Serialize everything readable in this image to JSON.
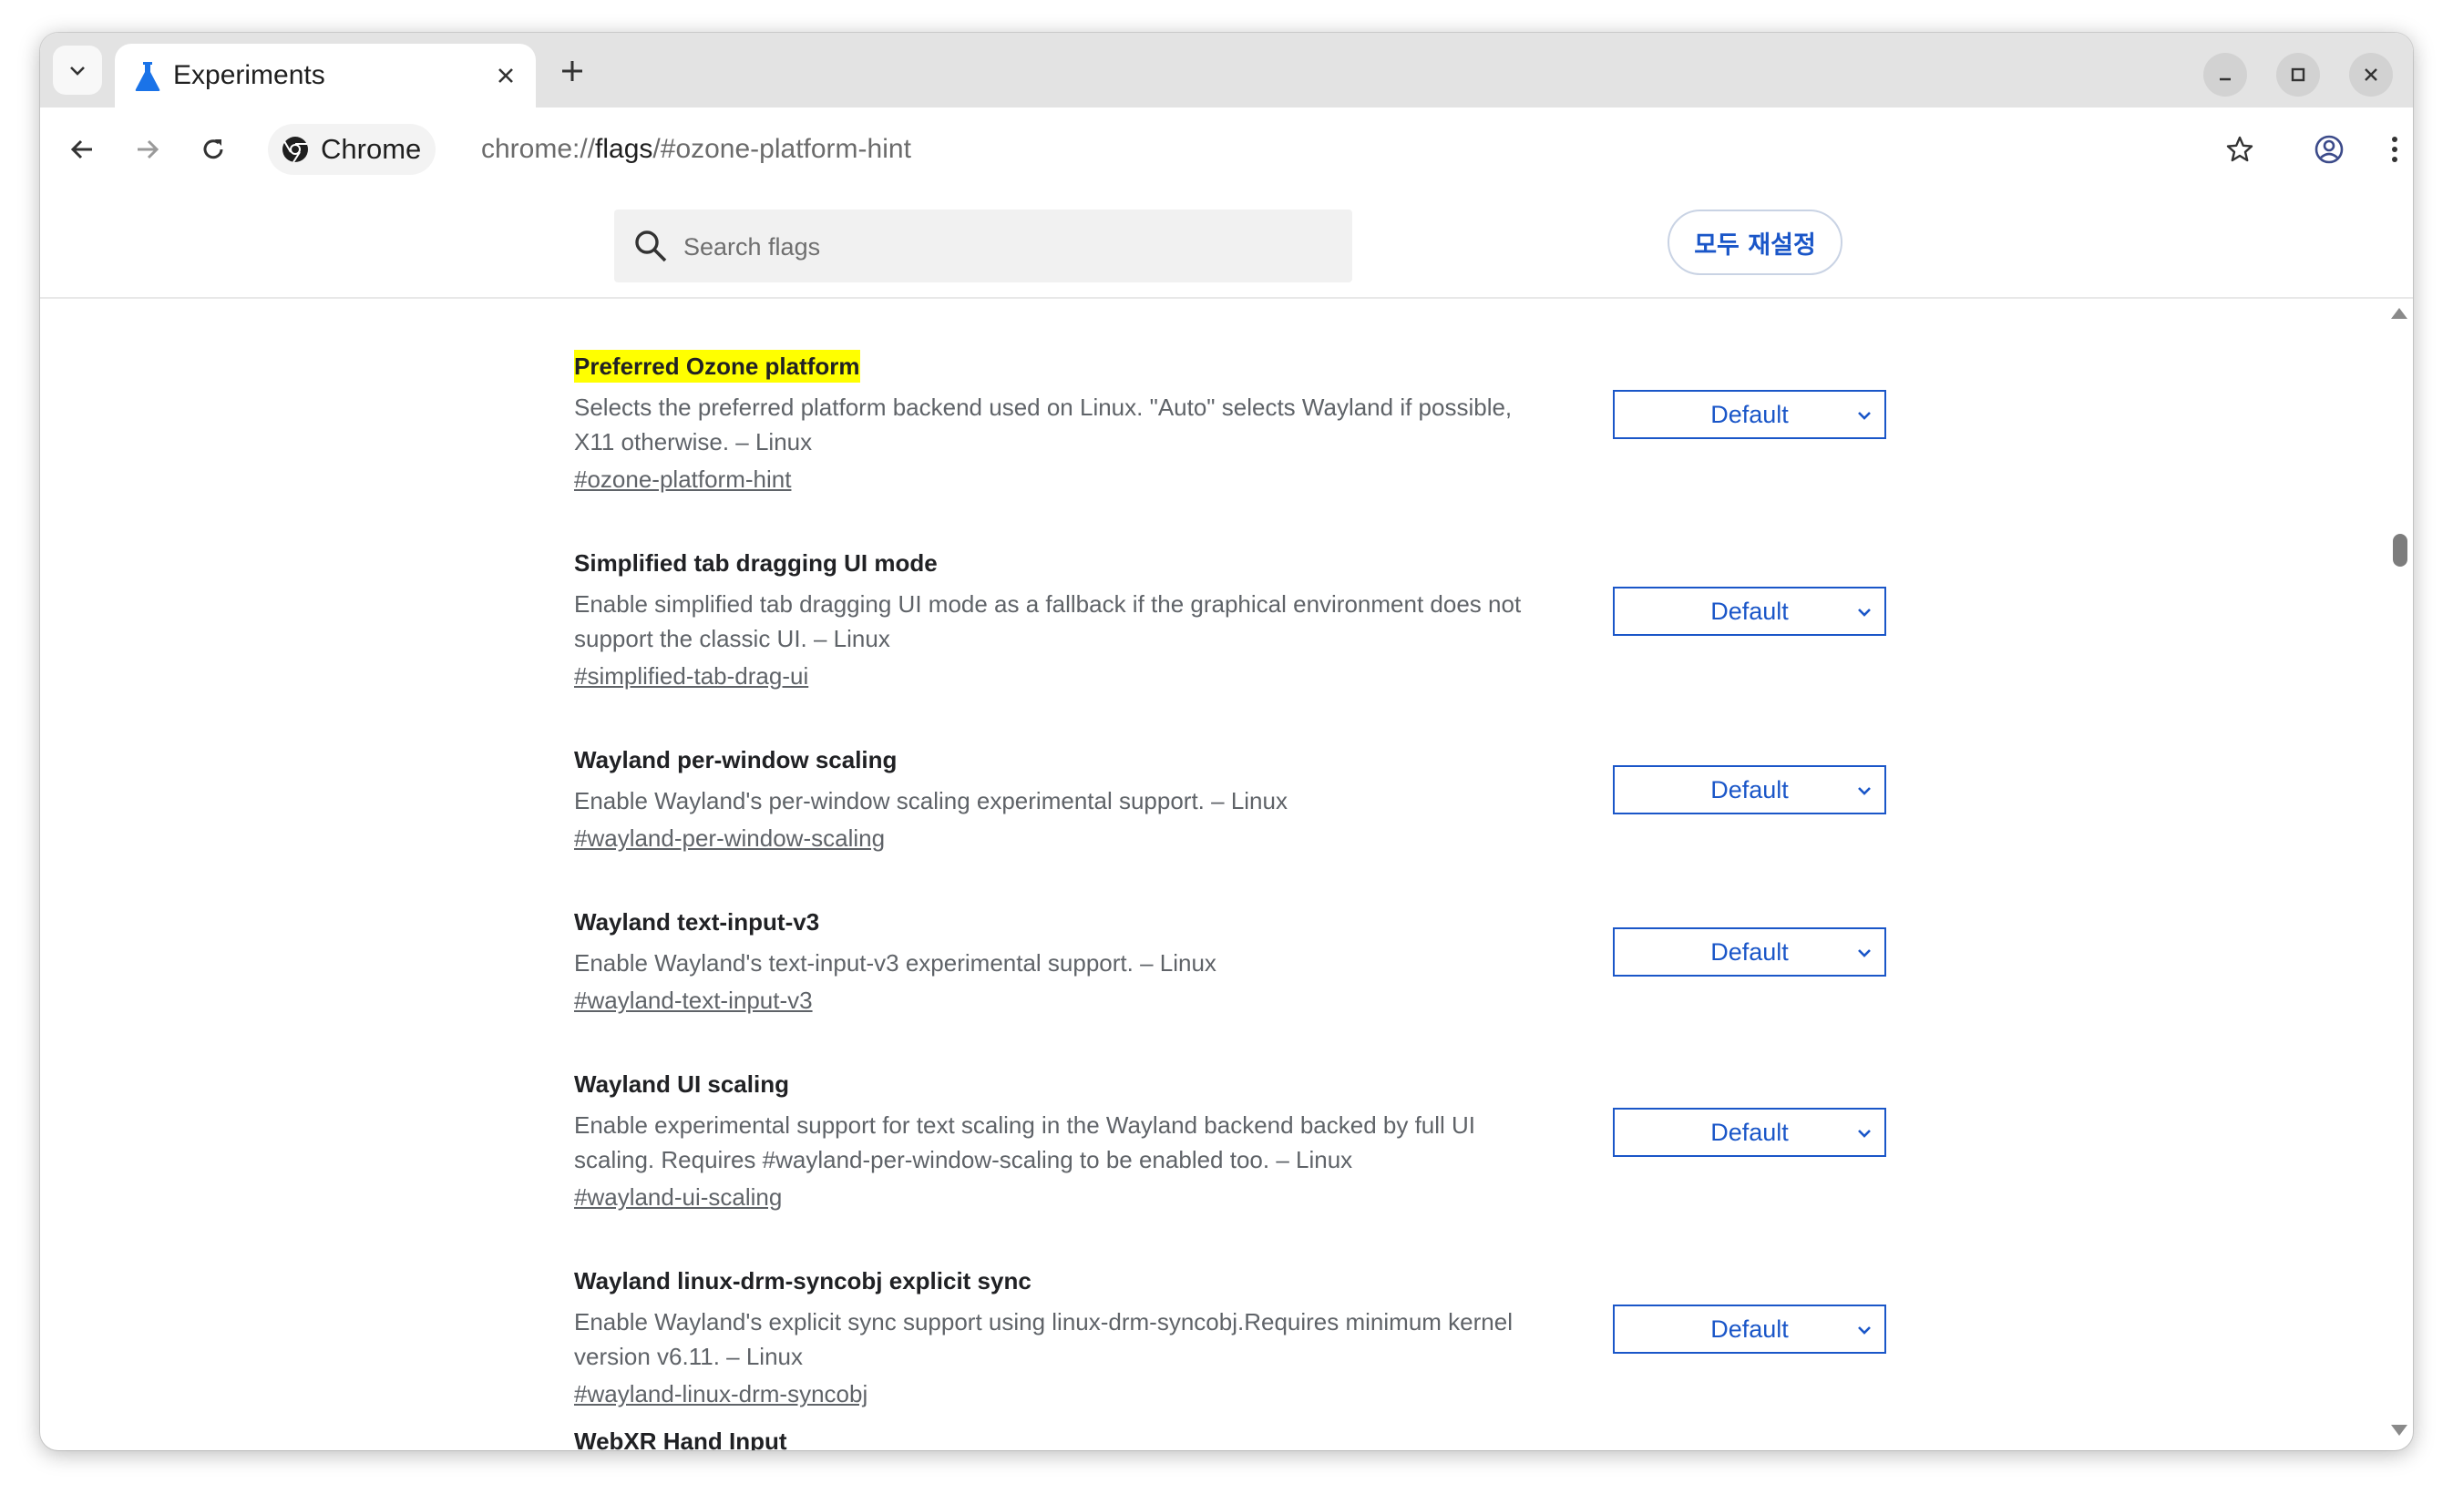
{
  "browser": {
    "tab": {
      "title": "Experiments"
    },
    "chip_label": "Chrome",
    "url_prefix": "chrome://",
    "url_bold": "flags",
    "url_suffix": "/#ozone-platform-hint"
  },
  "header": {
    "search_placeholder": "Search flags",
    "reset_label": "모두 재설정"
  },
  "flags": [
    {
      "title": "Preferred Ozone platform",
      "description": "Selects the preferred platform backend used on Linux. \"Auto\" selects Wayland if possible, X11 otherwise. – Linux",
      "link": "#ozone-platform-hint",
      "value": "Default",
      "highlighted": true
    },
    {
      "title": "Simplified tab dragging UI mode",
      "description": "Enable simplified tab dragging UI mode as a fallback if the graphical environment does not support the classic UI. – Linux",
      "link": "#simplified-tab-drag-ui",
      "value": "Default"
    },
    {
      "title": "Wayland per-window scaling",
      "description": "Enable Wayland's per-window scaling experimental support. – Linux",
      "link": "#wayland-per-window-scaling",
      "value": "Default"
    },
    {
      "title": "Wayland text-input-v3",
      "description": "Enable Wayland's text-input-v3 experimental support. – Linux",
      "link": "#wayland-text-input-v3",
      "value": "Default"
    },
    {
      "title": "Wayland UI scaling",
      "description": "Enable experimental support for text scaling in the Wayland backend backed by full UI scaling. Requires #wayland-per-window-scaling to be enabled too. – Linux",
      "link": "#wayland-ui-scaling",
      "value": "Default"
    },
    {
      "title": "Wayland linux-drm-syncobj explicit sync",
      "description": "Enable Wayland's explicit sync support using linux-drm-syncobj.Requires minimum kernel version v6.11. – Linux",
      "link": "#wayland-linux-drm-syncobj",
      "value": "Default"
    },
    {
      "title": "WebXR Hand Input"
    }
  ],
  "colors": {
    "accent": "#1a56c8",
    "highlight": "#ffff00",
    "tabstrip": "#e3e3e3"
  },
  "icons": [
    "tab-search-icon",
    "flask-icon",
    "close-icon",
    "plus-icon",
    "minimize-icon",
    "maximize-icon",
    "back-icon",
    "forward-icon",
    "reload-icon",
    "chrome-logo-icon",
    "star-icon",
    "profile-icon",
    "menu-icon",
    "search-icon",
    "chevron-down-icon"
  ]
}
